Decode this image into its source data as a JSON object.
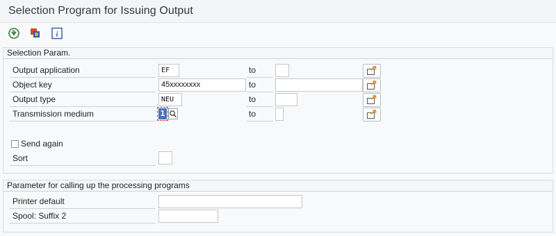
{
  "window": {
    "title": "Selection Program for Issuing Output"
  },
  "toolbar": {
    "execute_icon": "execute-icon",
    "variants_icon": "get-variant-icon",
    "info_icon": "info-icon"
  },
  "selection": {
    "title": "Selection Param.",
    "rows": [
      {
        "label": "Output application",
        "from": "EF",
        "to_label": "to",
        "to": ""
      },
      {
        "label": "Object key",
        "from": "45xxxxxxxx",
        "to_label": "to",
        "to": ""
      },
      {
        "label": "Output type",
        "from": "NEU",
        "to_label": "to",
        "to": ""
      },
      {
        "label": "Transmission medium",
        "from": "1",
        "to_label": "to",
        "to": ""
      }
    ],
    "send_again_label": "Send again",
    "send_again_checked": false,
    "sort_label": "Sort",
    "sort_value": ""
  },
  "params": {
    "title": "Parameter for calling up the processing programs",
    "printer_label": "Printer default",
    "printer_value": "",
    "spool_label": "Spool: Suffix 2",
    "spool_value": ""
  }
}
